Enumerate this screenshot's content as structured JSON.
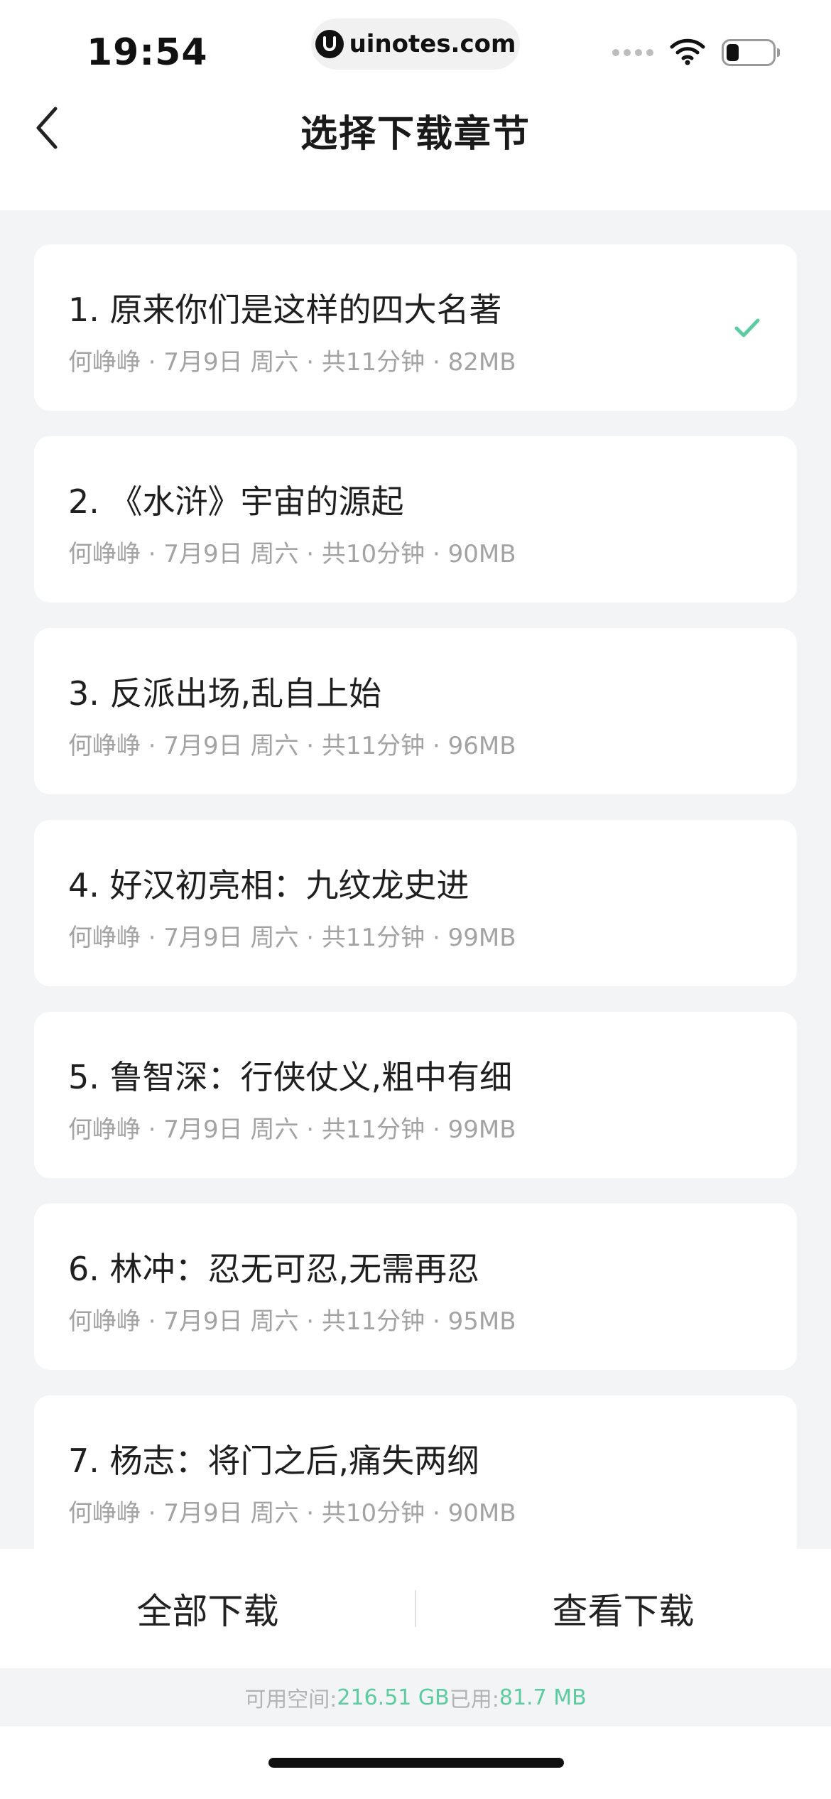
{
  "status_bar": {
    "time": "19:54",
    "url": "uinotes.com",
    "battery_level": 0.28
  },
  "nav": {
    "title": "选择下载章节",
    "back_icon": "chevron-left-icon"
  },
  "chapters": [
    {
      "title": "1. 原来你们是这样的四大名著",
      "meta": "何峥峥 · 7月9日 周六 · 共11分钟 · 82MB",
      "selected": true
    },
    {
      "title": "2. 《水浒》宇宙的源起",
      "meta": "何峥峥 · 7月9日 周六 · 共10分钟 · 90MB",
      "selected": false
    },
    {
      "title": "3. 反派出场,乱自上始",
      "meta": "何峥峥 · 7月9日 周六 · 共11分钟 · 96MB",
      "selected": false
    },
    {
      "title": "4. 好汉初亮相：九纹龙史进",
      "meta": "何峥峥 · 7月9日 周六 · 共11分钟 · 99MB",
      "selected": false
    },
    {
      "title": "5. 鲁智深：行侠仗义,粗中有细",
      "meta": "何峥峥 · 7月9日 周六 · 共11分钟 · 99MB",
      "selected": false
    },
    {
      "title": "6. 林冲：忍无可忍,无需再忍",
      "meta": "何峥峥 · 7月9日 周六 · 共11分钟 · 95MB",
      "selected": false
    },
    {
      "title": "7. 杨志：将门之后,痛失两纲",
      "meta": "何峥峥 · 7月9日 周六 · 共10分钟 · 90MB",
      "selected": false
    }
  ],
  "actions": {
    "download_all": "全部下载",
    "view_downloads": "查看下载"
  },
  "storage": {
    "available_label": "可用空间: ",
    "available_value": "216.51 GB",
    "used_label": " 已用: ",
    "used_value": "81.7 MB"
  },
  "colors": {
    "accent": "#5ccca0",
    "background": "#f3f4f6",
    "card": "#ffffff",
    "meta_text": "#a3a3a3"
  }
}
